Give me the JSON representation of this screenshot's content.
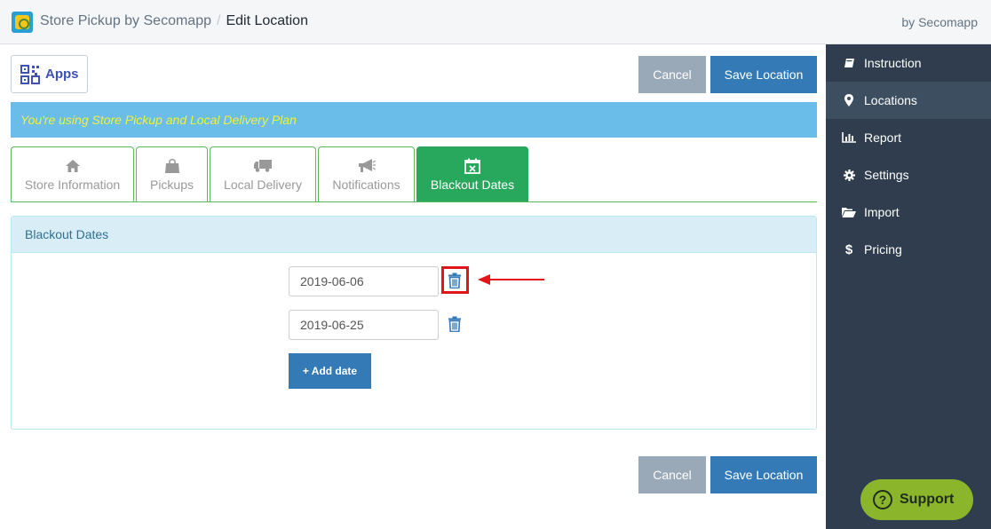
{
  "header": {
    "app_name": "Store Pickup by Secomapp",
    "separator": "/",
    "page": "Edit Location",
    "by": "by Secomapp"
  },
  "sidebar": {
    "items": [
      {
        "label": "Instruction",
        "icon": "book-icon"
      },
      {
        "label": "Locations",
        "icon": "map-marker-icon",
        "active": true
      },
      {
        "label": "Report",
        "icon": "bar-chart-icon"
      },
      {
        "label": "Settings",
        "icon": "gear-icon"
      },
      {
        "label": "Import",
        "icon": "folder-open-icon"
      },
      {
        "label": "Pricing",
        "icon": "dollar-icon"
      }
    ]
  },
  "toolbar": {
    "apps_label": "Apps",
    "cancel_label": "Cancel",
    "save_label": "Save Location"
  },
  "plan_notice": "You're using Store Pickup and Local Delivery Plan",
  "tabs": [
    {
      "label": "Store Information",
      "icon": "home-icon"
    },
    {
      "label": "Pickups",
      "icon": "shopping-bag-icon"
    },
    {
      "label": "Local Delivery",
      "icon": "truck-icon"
    },
    {
      "label": "Notifications",
      "icon": "bullhorn-icon"
    },
    {
      "label": "Blackout Dates",
      "icon": "calendar-x-icon",
      "active": true
    }
  ],
  "panel": {
    "title": "Blackout Dates",
    "dates": [
      "2019-06-06",
      "2019-06-25"
    ],
    "add_label": "+ Add date"
  },
  "footer": {
    "cancel_label": "Cancel",
    "save_label": "Save Location"
  },
  "support_label": "Support",
  "colors": {
    "primary": "#337ab7",
    "success": "#28a85c",
    "sidebar": "#2f3d4e",
    "annotation": "#e2151b"
  }
}
